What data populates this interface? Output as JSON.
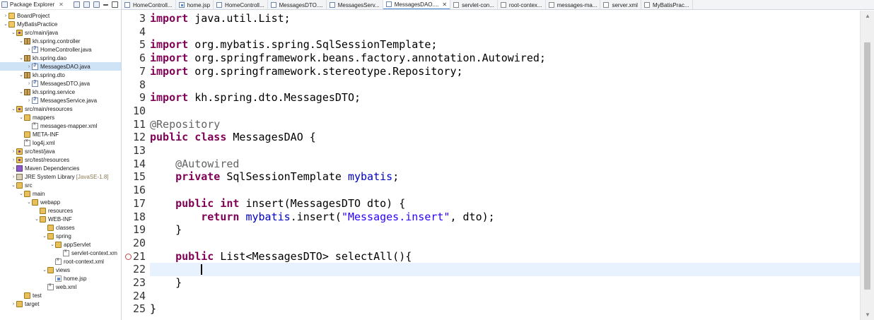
{
  "explorer": {
    "title": "Package Explorer",
    "close": "✕",
    "items": [
      {
        "label": "BoardProject",
        "twisty": "›",
        "icon": "project",
        "depth": 0
      },
      {
        "label": "MyBatisPractice",
        "twisty": "⌄",
        "icon": "project",
        "depth": 0
      },
      {
        "label": "src/main/java",
        "twisty": "⌄",
        "icon": "srcfolder",
        "depth": 1
      },
      {
        "label": "kh.spring.controller",
        "twisty": "⌄",
        "icon": "pkg",
        "depth": 2
      },
      {
        "label": "HomeController.java",
        "twisty": "›",
        "icon": "javafile",
        "depth": 3
      },
      {
        "label": "kh.spring.dao",
        "twisty": "⌄",
        "icon": "pkg",
        "depth": 2
      },
      {
        "label": "MessagesDAO.java",
        "twisty": "›",
        "icon": "javafile",
        "depth": 3,
        "selected": true
      },
      {
        "label": "kh.spring.dto",
        "twisty": "⌄",
        "icon": "pkg",
        "depth": 2
      },
      {
        "label": "MessagesDTO.java",
        "twisty": "›",
        "icon": "javafile",
        "depth": 3
      },
      {
        "label": "kh.spring.service",
        "twisty": "⌄",
        "icon": "pkg",
        "depth": 2
      },
      {
        "label": "MessagesService.java",
        "twisty": "›",
        "icon": "javafile",
        "depth": 3
      },
      {
        "label": "src/main/resources",
        "twisty": "⌄",
        "icon": "srcfolder",
        "depth": 1
      },
      {
        "label": "mappers",
        "twisty": "⌄",
        "icon": "folder",
        "depth": 2
      },
      {
        "label": "messages-mapper.xml",
        "twisty": "",
        "icon": "xmlfile",
        "depth": 3
      },
      {
        "label": "META-INF",
        "twisty": "",
        "icon": "folder",
        "depth": 2
      },
      {
        "label": "log4j.xml",
        "twisty": "",
        "icon": "xmlfile",
        "depth": 2
      },
      {
        "label": "src/test/java",
        "twisty": "›",
        "icon": "srcfolder",
        "depth": 1
      },
      {
        "label": "src/test/resources",
        "twisty": "›",
        "icon": "srcfolder",
        "depth": 1
      },
      {
        "label": "Maven Dependencies",
        "twisty": "›",
        "icon": "maven",
        "depth": 1
      },
      {
        "label": "JRE System Library",
        "suffix": "[JavaSE-1.8]",
        "twisty": "›",
        "icon": "lib",
        "depth": 1
      },
      {
        "label": "src",
        "twisty": "⌄",
        "icon": "folder",
        "depth": 1
      },
      {
        "label": "main",
        "twisty": "⌄",
        "icon": "folder",
        "depth": 2
      },
      {
        "label": "webapp",
        "twisty": "⌄",
        "icon": "folder",
        "depth": 3
      },
      {
        "label": "resources",
        "twisty": "",
        "icon": "folder",
        "depth": 4
      },
      {
        "label": "WEB-INF",
        "twisty": "⌄",
        "icon": "folder",
        "depth": 4
      },
      {
        "label": "classes",
        "twisty": "",
        "icon": "folder",
        "depth": 5
      },
      {
        "label": "spring",
        "twisty": "⌄",
        "icon": "folder",
        "depth": 5
      },
      {
        "label": "appServlet",
        "twisty": "⌄",
        "icon": "folder",
        "depth": 6
      },
      {
        "label": "servlet-context.xm",
        "twisty": "",
        "icon": "xmlfile",
        "depth": 7
      },
      {
        "label": "root-context.xml",
        "twisty": "",
        "icon": "xmlfile",
        "depth": 6
      },
      {
        "label": "views",
        "twisty": "⌄",
        "icon": "folder",
        "depth": 5
      },
      {
        "label": "home.jsp",
        "twisty": "",
        "icon": "jsp",
        "depth": 6
      },
      {
        "label": "web.xml",
        "twisty": "",
        "icon": "xmlfile",
        "depth": 5
      },
      {
        "label": "test",
        "twisty": "",
        "icon": "folder",
        "depth": 2
      },
      {
        "label": "target",
        "twisty": "›",
        "icon": "folder",
        "depth": 1
      }
    ]
  },
  "tabs": [
    {
      "label": "HomeControll...",
      "icon": "java"
    },
    {
      "label": "home.jsp",
      "icon": "jsp"
    },
    {
      "label": "HomeControll...",
      "icon": "java"
    },
    {
      "label": "MessagesDTO....",
      "icon": "java"
    },
    {
      "label": "MessagesServ...",
      "icon": "java"
    },
    {
      "label": "MessagesDAO....",
      "icon": "java",
      "active": true,
      "close": "✕"
    },
    {
      "label": "servlet-con...",
      "icon": "xml"
    },
    {
      "label": "root-contex...",
      "icon": "xml"
    },
    {
      "label": "messages-ma...",
      "icon": "xml"
    },
    {
      "label": "server.xml",
      "icon": "xml"
    },
    {
      "label": "MyBatisPrac...",
      "icon": "xml"
    }
  ],
  "editor": {
    "lines": [
      {
        "num": "3",
        "fold": "⊖",
        "tokens": [
          [
            "kw",
            "import"
          ],
          [
            "t",
            " java.util.List;"
          ]
        ]
      },
      {
        "num": "4",
        "tokens": []
      },
      {
        "num": "5",
        "tokens": [
          [
            "kw",
            "import"
          ],
          [
            "t",
            " org.mybatis.spring.SqlSessionTemplate;"
          ]
        ]
      },
      {
        "num": "6",
        "tokens": [
          [
            "kw",
            "import"
          ],
          [
            "t",
            " org.springframework.beans.factory.annotation.Autowired;"
          ]
        ]
      },
      {
        "num": "7",
        "tokens": [
          [
            "kw",
            "import"
          ],
          [
            "t",
            " org.springframework.stereotype.Repository;"
          ]
        ]
      },
      {
        "num": "8",
        "tokens": []
      },
      {
        "num": "9",
        "tokens": [
          [
            "kw",
            "import"
          ],
          [
            "t",
            " kh.spring.dto.MessagesDTO;"
          ]
        ]
      },
      {
        "num": "10",
        "tokens": []
      },
      {
        "num": "11",
        "tokens": [
          [
            "ann",
            "@Repository"
          ]
        ]
      },
      {
        "num": "12",
        "tokens": [
          [
            "kw",
            "public"
          ],
          [
            "t",
            " "
          ],
          [
            "kw",
            "class"
          ],
          [
            "t",
            " MessagesDAO {"
          ]
        ]
      },
      {
        "num": "13",
        "tokens": []
      },
      {
        "num": "14",
        "fold": "⊖",
        "tokens": [
          [
            "t",
            "    "
          ],
          [
            "ann",
            "@Autowired"
          ]
        ]
      },
      {
        "num": "15",
        "tokens": [
          [
            "t",
            "    "
          ],
          [
            "kw",
            "private"
          ],
          [
            "t",
            " SqlSessionTemplate "
          ],
          [
            "fld",
            "mybatis"
          ],
          [
            "t",
            ";"
          ]
        ]
      },
      {
        "num": "16",
        "tokens": []
      },
      {
        "num": "17",
        "fold": "⊖",
        "tokens": [
          [
            "t",
            "    "
          ],
          [
            "kw",
            "public"
          ],
          [
            "t",
            " "
          ],
          [
            "kw",
            "int"
          ],
          [
            "t",
            " insert(MessagesDTO dto) {"
          ]
        ]
      },
      {
        "num": "18",
        "tokens": [
          [
            "t",
            "        "
          ],
          [
            "kw",
            "return"
          ],
          [
            "t",
            " "
          ],
          [
            "fld",
            "mybatis"
          ],
          [
            "t",
            ".insert("
          ],
          [
            "str",
            "\"Messages.insert\""
          ],
          [
            "t",
            ", dto);"
          ]
        ]
      },
      {
        "num": "19",
        "tokens": [
          [
            "t",
            "    }"
          ]
        ]
      },
      {
        "num": "20",
        "tokens": []
      },
      {
        "num": "21",
        "fold": "⊖",
        "error": true,
        "tokens": [
          [
            "t",
            "    "
          ],
          [
            "kw",
            "public"
          ],
          [
            "t",
            " List<MessagesDTO> selectAll(){"
          ]
        ]
      },
      {
        "num": "22",
        "current": true,
        "caret": true,
        "tokens": [
          [
            "t",
            "        "
          ]
        ]
      },
      {
        "num": "23",
        "tokens": [
          [
            "t",
            "    }"
          ]
        ]
      },
      {
        "num": "24",
        "tokens": []
      },
      {
        "num": "25",
        "tokens": [
          [
            "t",
            "}"
          ]
        ]
      }
    ]
  },
  "scrollbar": {
    "up": "▲",
    "down": "▼"
  }
}
